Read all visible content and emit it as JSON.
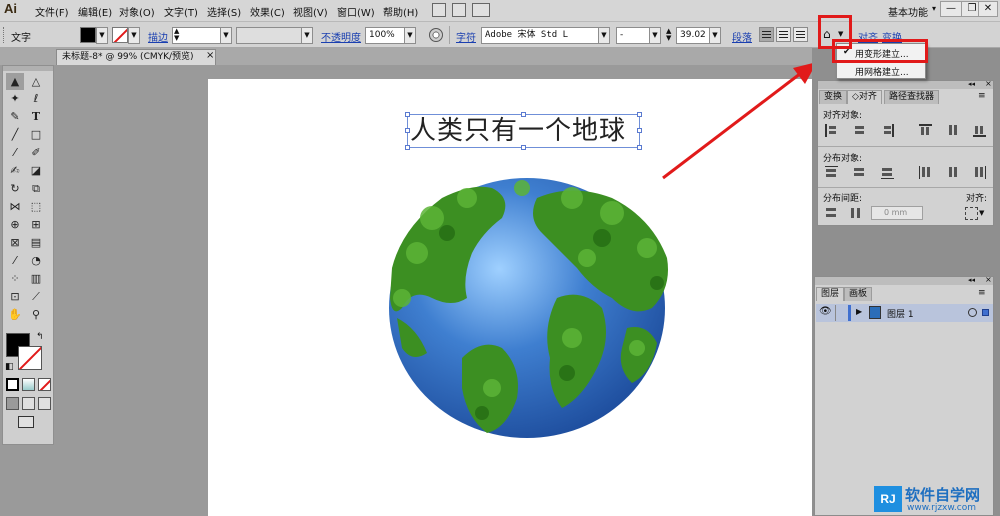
{
  "app": {
    "logo": "Ai"
  },
  "menubar": {
    "items": [
      "文件(F)",
      "编辑(E)",
      "对象(O)",
      "文字(T)",
      "选择(S)",
      "效果(C)",
      "视图(V)",
      "窗口(W)",
      "帮助(H)"
    ],
    "workspace": "基本功能",
    "window_buttons": [
      "—",
      "❐",
      "✕"
    ]
  },
  "controlbar": {
    "selection_label": "文字",
    "stroke_label": "描边",
    "opacity_label": "不透明度",
    "opacity_value": "100%",
    "character_label": "字符",
    "font_name": "Adobe 宋体 Std L",
    "font_style": "-",
    "font_size": "39.02",
    "paragraph_label": "段落",
    "align_label": "对齐",
    "transform_label": "变换"
  },
  "document": {
    "tab_title": "未标题-8* @ 99% (CMYK/预览)",
    "tab_close": "×"
  },
  "canvas": {
    "headline": "人类只有一个地球"
  },
  "dropdown_menu": {
    "items": [
      {
        "label": "用变形建立...",
        "checked": true,
        "checkmark": "✔"
      },
      {
        "label": "用网格建立...",
        "checked": false,
        "checkmark": ""
      }
    ]
  },
  "align_panel": {
    "tabs": [
      "变换",
      "对齐",
      "路径查找器"
    ],
    "tab_prefix_icon": "◇",
    "section_align_objects": "对齐对象:",
    "section_distribute_objects": "分布对象:",
    "section_distribute_spacing": "分布间距:",
    "align_to_label": "对齐:",
    "spacing_value": "0 mm"
  },
  "layers_panel": {
    "tabs": [
      "图层",
      "画板"
    ],
    "layer_name": "图层 1"
  },
  "watermark": {
    "text": "软件自学网",
    "url": "www.rjzxw.com",
    "logo_letters": "RJ"
  },
  "colors": {
    "accent_red": "#e11a1a",
    "link_blue": "#1a3fb0",
    "selection_blue": "#5a7ad0",
    "ocean_blue": "#3f7fd0",
    "forest_green": "#3c8f22"
  },
  "icons": [
    "selection-tool-icon",
    "direct-selection-icon",
    "magic-wand-icon",
    "lasso-icon",
    "pen-icon",
    "type-icon",
    "line-icon",
    "rectangle-icon",
    "paintbrush-icon",
    "pencil-icon",
    "blob-brush-icon",
    "eraser-icon",
    "rotate-icon",
    "scale-icon",
    "width-icon",
    "free-transform-icon",
    "shape-builder-icon",
    "perspective-grid-icon",
    "mesh-icon",
    "gradient-icon",
    "eyedropper-icon",
    "blend-icon",
    "symbol-sprayer-icon",
    "column-graph-icon",
    "artboard-icon",
    "slice-icon",
    "hand-icon",
    "zoom-icon"
  ]
}
